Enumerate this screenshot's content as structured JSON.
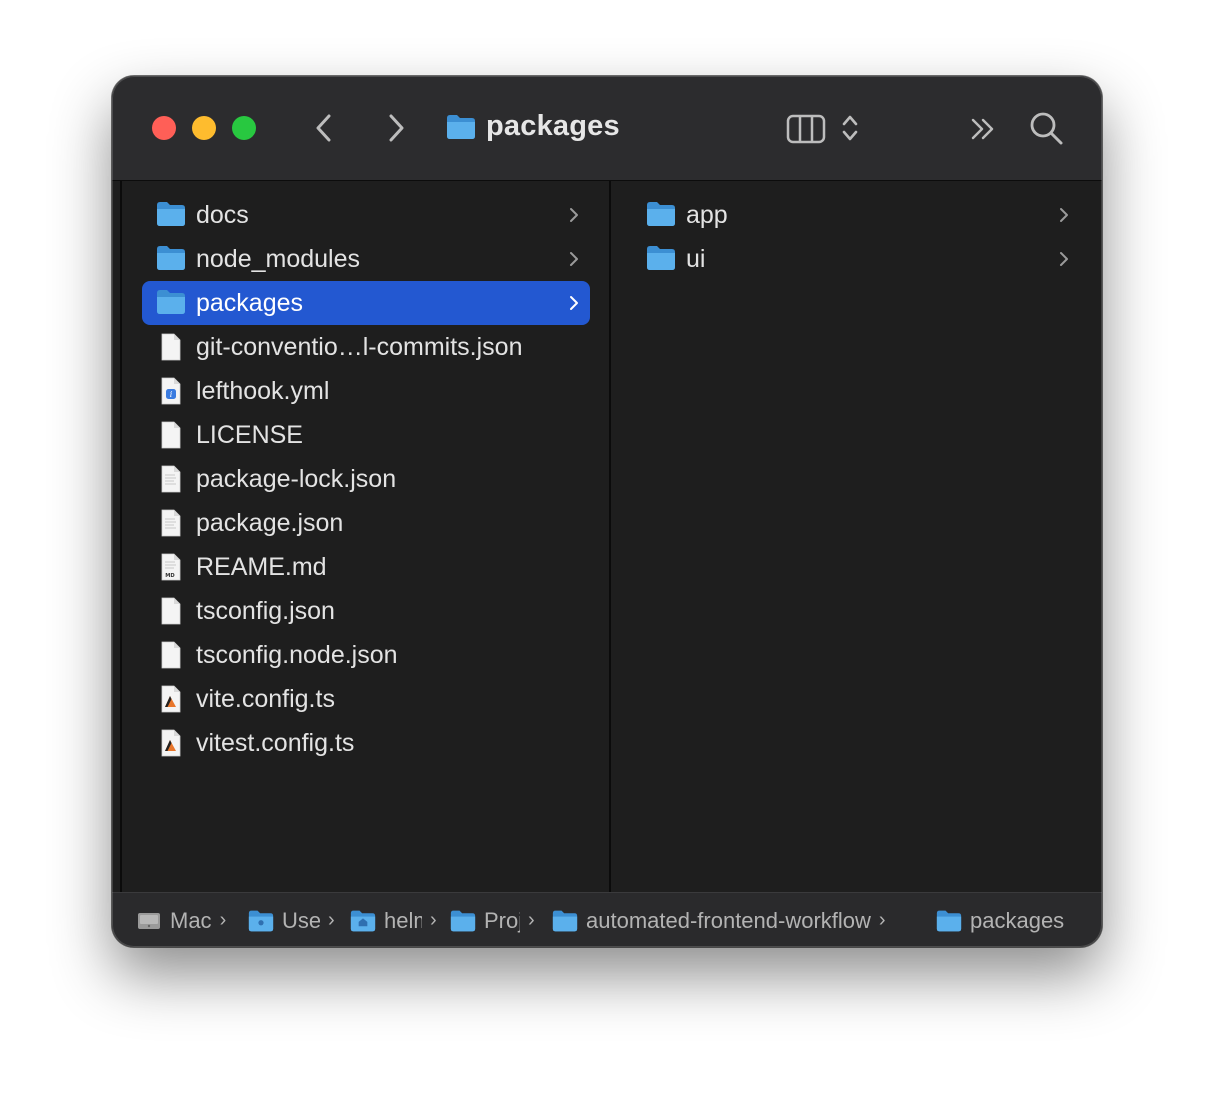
{
  "window": {
    "title": "packages",
    "traffic_lights": {
      "close": "#ff5f57",
      "minimize": "#febc2e",
      "maximize": "#28c840"
    }
  },
  "toolbar": {
    "back_icon": "chevron-left-icon",
    "forward_icon": "chevron-right-icon",
    "view_icon": "column-view-icon",
    "overflow_icon": "double-chevron-icon",
    "search_icon": "magnifier-icon"
  },
  "columns": [
    {
      "items": [
        {
          "name": "docs",
          "kind": "folder",
          "has_children": true
        },
        {
          "name": "node_modules",
          "kind": "folder",
          "has_children": true
        },
        {
          "name": "packages",
          "kind": "folder",
          "has_children": true,
          "selected": true
        },
        {
          "name": "git-conventio…l-commits.json",
          "kind": "file"
        },
        {
          "name": "lefthook.yml",
          "kind": "yml-file"
        },
        {
          "name": "LICENSE",
          "kind": "file"
        },
        {
          "name": "package-lock.json",
          "kind": "text-file"
        },
        {
          "name": "package.json",
          "kind": "text-file"
        },
        {
          "name": "REAME.md",
          "kind": "md-file",
          "badge": "MD"
        },
        {
          "name": "tsconfig.json",
          "kind": "file"
        },
        {
          "name": "tsconfig.node.json",
          "kind": "file"
        },
        {
          "name": "vite.config.ts",
          "kind": "ts-file"
        },
        {
          "name": "vitest.config.ts",
          "kind": "ts-file"
        }
      ]
    },
    {
      "items": [
        {
          "name": "app",
          "kind": "folder",
          "has_children": true
        },
        {
          "name": "ui",
          "kind": "folder",
          "has_children": true
        }
      ]
    }
  ],
  "pathbar": [
    {
      "label": "Mac",
      "icon": "disk-icon"
    },
    {
      "label": "Users",
      "icon": "users-folder-icon"
    },
    {
      "label": "helmut",
      "icon": "home-folder-icon"
    },
    {
      "label": "Projects",
      "icon": "folder-icon"
    },
    {
      "label": "automated-frontend-workflow",
      "icon": "folder-icon"
    },
    {
      "label": "packages",
      "icon": "folder-icon"
    }
  ],
  "colors": {
    "selection": "#2358d1",
    "folder": "#5bb0ec",
    "window_bg": "#1e1e1e",
    "toolbar_bg": "#2c2c2e"
  }
}
